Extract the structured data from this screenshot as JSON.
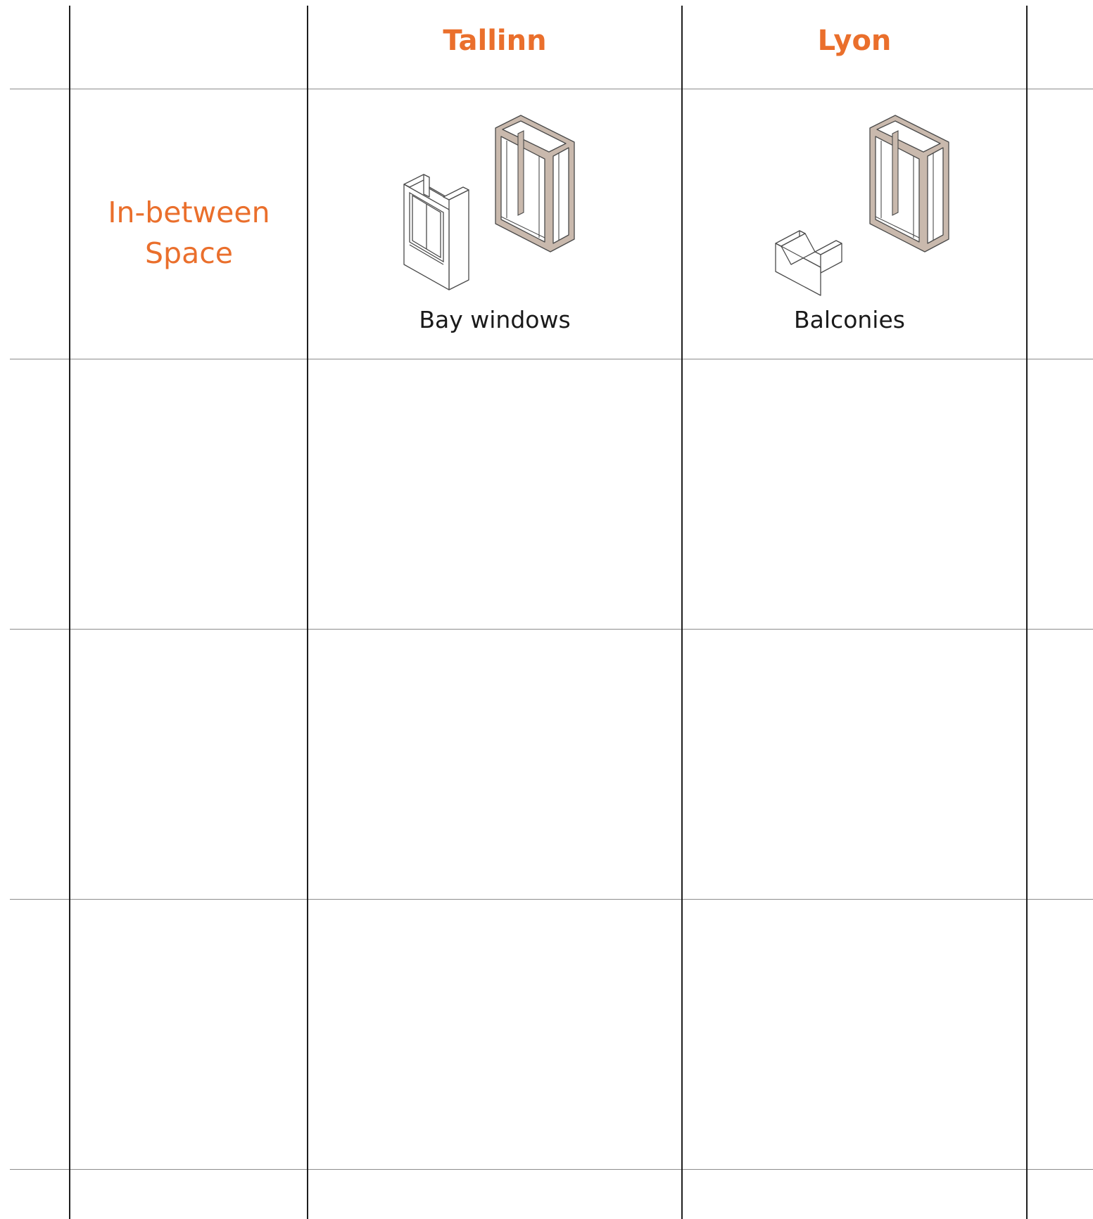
{
  "columns": {
    "tallinn": "Tallinn",
    "lyon": "Lyon"
  },
  "rows": [
    {
      "label_lines": [
        "In-between",
        "Space"
      ],
      "tallinn_caption": "Bay windows",
      "lyon_caption": "Balconies"
    }
  ],
  "colors": {
    "accent": "#ea6f2c",
    "text": "#1a1a1a",
    "frame_fill": "#c9b9ad",
    "frame_stroke": "#4a4a4a"
  },
  "icons": {
    "tallinn_cell": [
      "bay-window-icon",
      "frame-icon"
    ],
    "lyon_cell": [
      "balcony-icon",
      "frame-icon"
    ]
  }
}
